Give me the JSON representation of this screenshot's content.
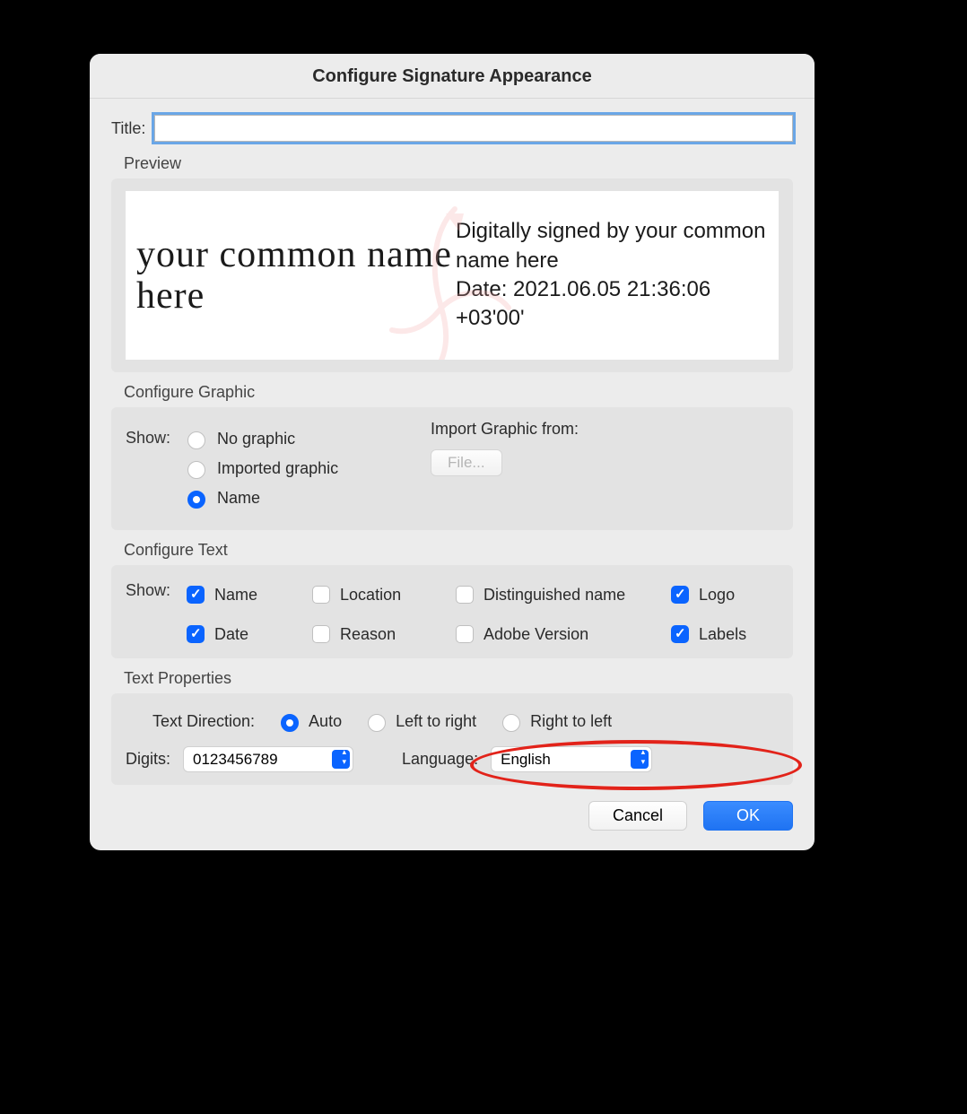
{
  "dialog": {
    "title": "Configure Signature Appearance",
    "titleField": {
      "label": "Title:",
      "value": ""
    },
    "preview": {
      "label": "Preview",
      "leftText": "your common name here",
      "rightLine1": "Digitally signed by your common name here",
      "rightLine2": "Date: 2021.06.05 21:36:06 +03'00'"
    },
    "configureGraphic": {
      "label": "Configure Graphic",
      "showLabel": "Show:",
      "options": {
        "noGraphic": "No graphic",
        "importedGraphic": "Imported graphic",
        "name": "Name"
      },
      "selected": "name",
      "importLabel": "Import Graphic from:",
      "fileBtn": "File..."
    },
    "configureText": {
      "label": "Configure Text",
      "showLabel": "Show:",
      "checks": {
        "name": {
          "label": "Name",
          "checked": true
        },
        "location": {
          "label": "Location",
          "checked": false
        },
        "distinguished": {
          "label": "Distinguished name",
          "checked": false
        },
        "logo": {
          "label": "Logo",
          "checked": true
        },
        "date": {
          "label": "Date",
          "checked": true
        },
        "reason": {
          "label": "Reason",
          "checked": false
        },
        "adobeVersion": {
          "label": "Adobe Version",
          "checked": false
        },
        "labels": {
          "label": "Labels",
          "checked": true
        }
      }
    },
    "textProperties": {
      "label": "Text Properties",
      "directionLabel": "Text Direction:",
      "directions": {
        "auto": "Auto",
        "ltr": "Left to right",
        "rtl": "Right to left"
      },
      "directionSelected": "auto",
      "digitsLabel": "Digits:",
      "digitsValue": "0123456789",
      "languageLabel": "Language:",
      "languageValue": "English"
    },
    "buttons": {
      "cancel": "Cancel",
      "ok": "OK"
    }
  }
}
